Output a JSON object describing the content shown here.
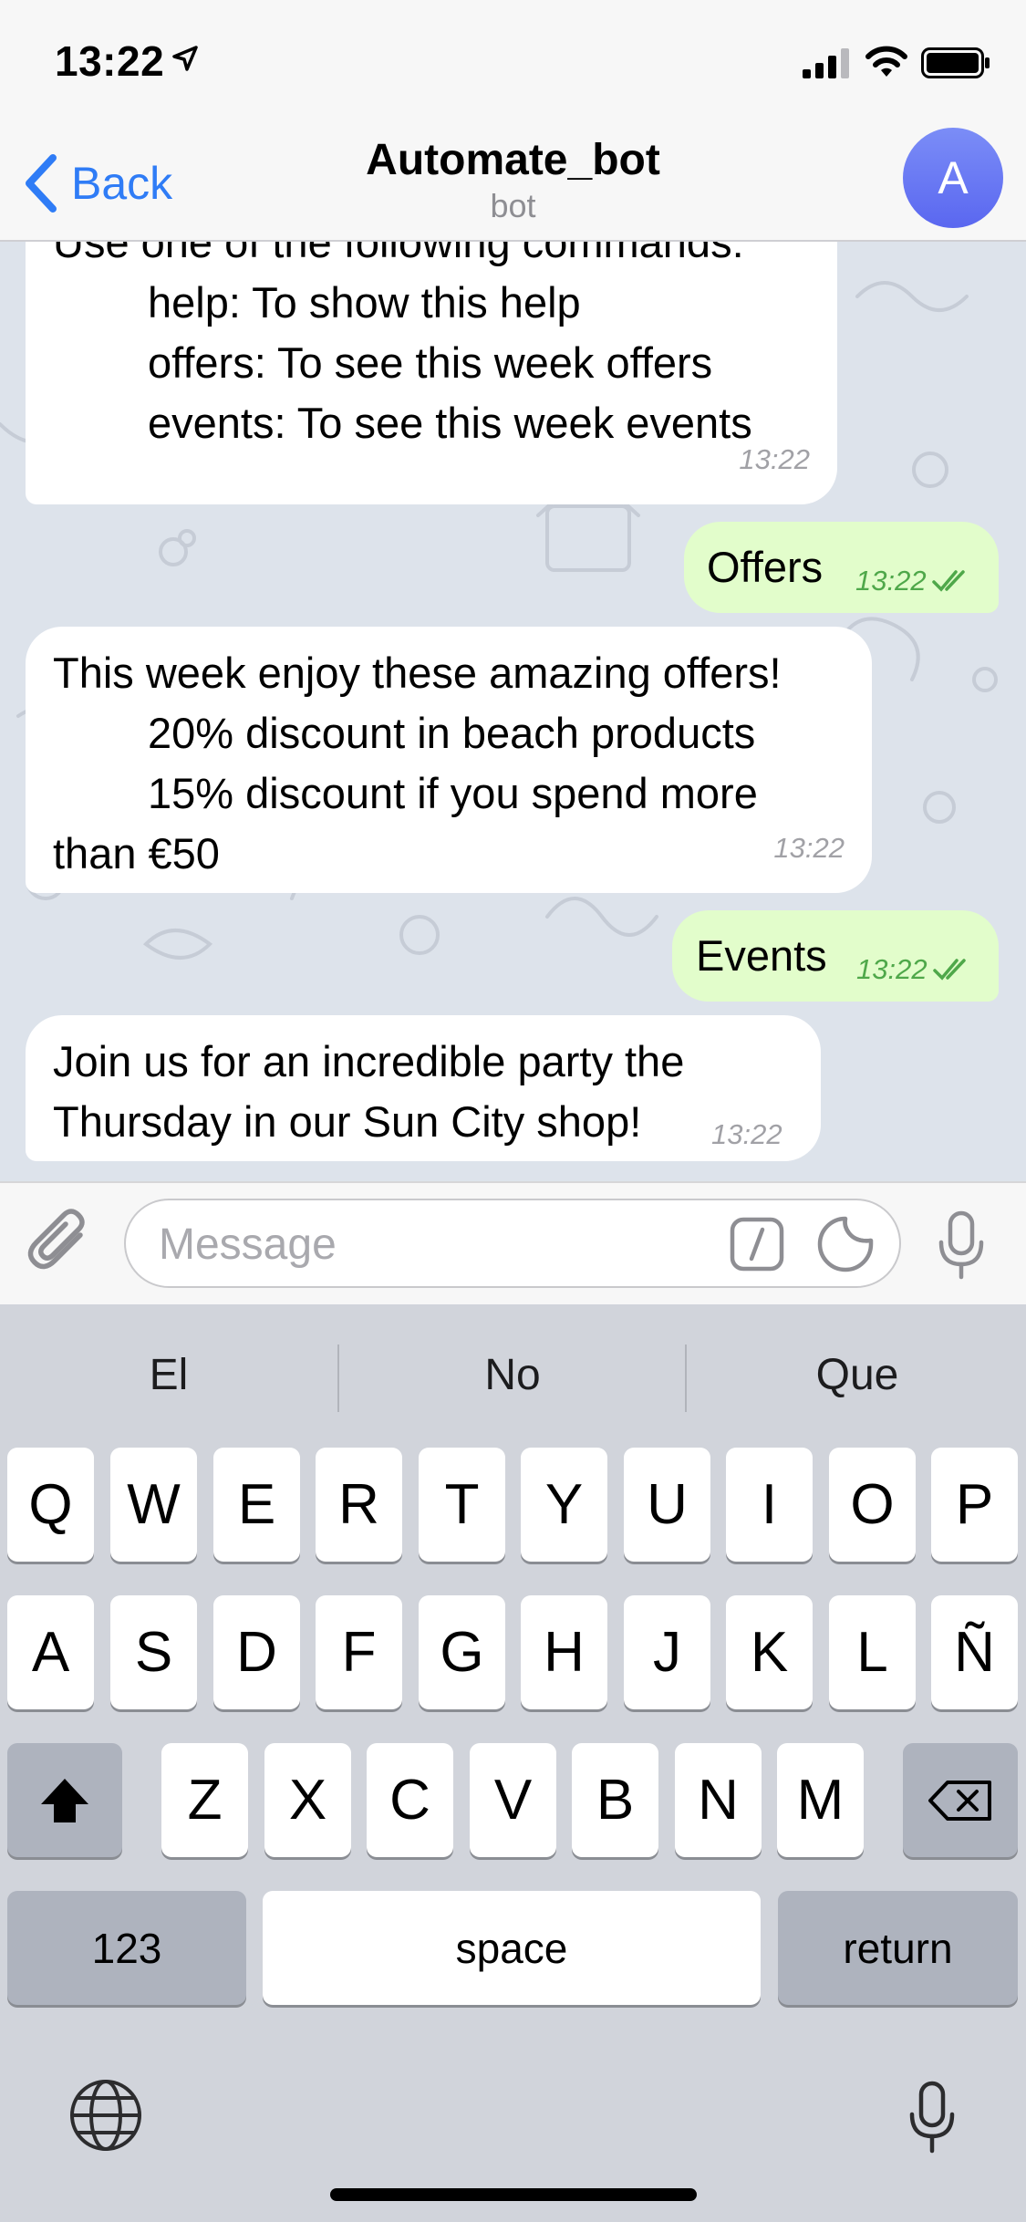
{
  "status": {
    "time": "13:22"
  },
  "nav": {
    "back_label": "Back",
    "title": "Automate_bot",
    "subtitle": "bot",
    "avatar_letter": "A"
  },
  "messages": [
    {
      "from": "bot",
      "lines": [
        "Use one of the following commands:",
        "help: To show this help",
        "offers: To see this week offers",
        "events: To see this week events"
      ],
      "time": "13:22"
    },
    {
      "from": "user",
      "text": "Offers",
      "time": "13:22",
      "status": "read"
    },
    {
      "from": "bot",
      "lines": [
        "This week enjoy these amazing offers!",
        "20% discount in beach products",
        "15% discount if you spend more",
        "than €50"
      ],
      "time": "13:22"
    },
    {
      "from": "user",
      "text": "Events",
      "time": "13:22",
      "status": "read"
    },
    {
      "from": "bot",
      "lines": [
        "Join us for an incredible party the",
        "Thursday in our Sun City shop!"
      ],
      "time": "13:22"
    }
  ],
  "input": {
    "placeholder": "Message"
  },
  "keyboard": {
    "suggestions": [
      "El",
      "No",
      "Que"
    ],
    "row1": [
      "Q",
      "W",
      "E",
      "R",
      "T",
      "Y",
      "U",
      "I",
      "O",
      "P"
    ],
    "row2": [
      "A",
      "S",
      "D",
      "F",
      "G",
      "H",
      "J",
      "K",
      "L",
      "Ñ"
    ],
    "row3": [
      "Z",
      "X",
      "C",
      "V",
      "B",
      "N",
      "M"
    ],
    "numbers_label": "123",
    "space_label": "space",
    "return_label": "return"
  },
  "colors": {
    "accent": "#2f7cf6",
    "outgoing_bubble": "#e2fdcb",
    "read_check": "#4fa84a"
  }
}
